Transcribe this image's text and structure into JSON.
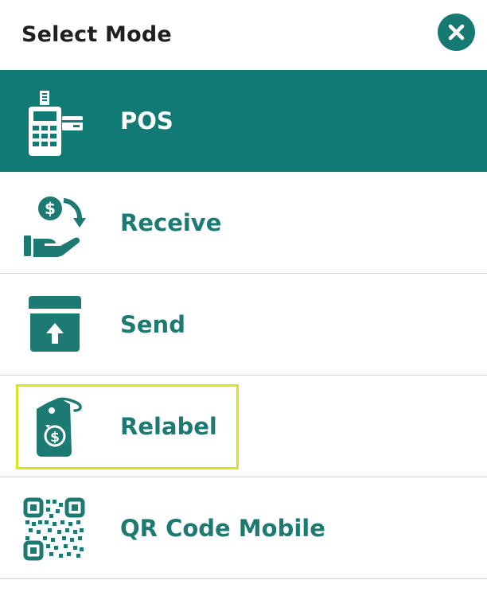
{
  "dialog": {
    "title": "Select Mode",
    "close_icon": "close-icon",
    "accent_color": "#167a73",
    "selected_bg": "#117a74",
    "focus_color": "#d8e422"
  },
  "modes": [
    {
      "label": "POS",
      "icon": "pos-terminal-icon",
      "selected": true
    },
    {
      "label": "Receive",
      "icon": "receive-money-icon",
      "selected": false
    },
    {
      "label": "Send",
      "icon": "send-box-icon",
      "selected": false
    },
    {
      "label": "Relabel",
      "icon": "price-tag-icon",
      "selected": false,
      "focused": true
    },
    {
      "label": "QR Code Mobile",
      "icon": "qr-code-icon",
      "selected": false
    }
  ]
}
